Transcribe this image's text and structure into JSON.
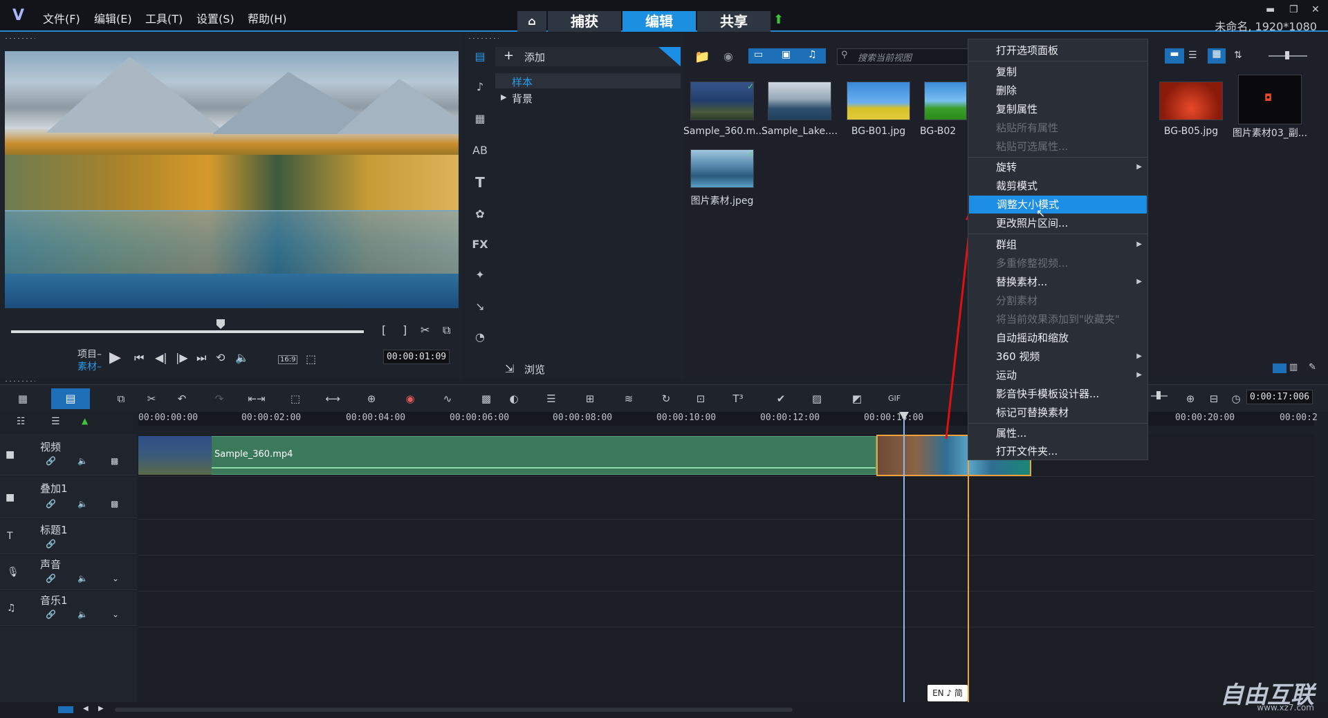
{
  "menubar": {
    "file": "文件(F)",
    "edit": "编辑(E)",
    "tools": "工具(T)",
    "settings": "设置(S)",
    "help": "帮助(H)"
  },
  "nav": {
    "capture": "捕获",
    "edit": "编辑",
    "share": "共享"
  },
  "window": {
    "title": "未命名, 1920*1080"
  },
  "player": {
    "project_label": "项目–",
    "clip_label": "素材–",
    "aspect": "16:9",
    "timecode": "00:00:01:09"
  },
  "library": {
    "add_label": "添加",
    "folders": [
      "样本",
      "背景"
    ],
    "browse_label": "浏览",
    "search_placeholder": "搜索当前视图",
    "thumbnails": [
      "Sample_360.m...",
      "Sample_Lake....",
      "BG-B01.jpg",
      "BG-B02",
      "BG-B05.jpg",
      "图片素材03_副...",
      "图片素材.jpeg"
    ]
  },
  "context_menu": {
    "items": [
      {
        "label": "打开选项面板",
        "disabled": false,
        "submenu": false
      },
      {
        "label": "复制",
        "disabled": false,
        "submenu": false
      },
      {
        "label": "删除",
        "disabled": false,
        "submenu": false
      },
      {
        "label": "复制属性",
        "disabled": false,
        "submenu": false
      },
      {
        "label": "粘贴所有属性",
        "disabled": true,
        "submenu": false
      },
      {
        "label": "粘贴可选属性...",
        "disabled": true,
        "submenu": false
      },
      {
        "label": "旋转",
        "disabled": false,
        "submenu": true
      },
      {
        "label": "裁剪模式",
        "disabled": false,
        "submenu": false
      },
      {
        "label": "调整大小模式",
        "disabled": false,
        "submenu": false,
        "highlighted": true
      },
      {
        "label": "更改照片区间...",
        "disabled": false,
        "submenu": false
      },
      {
        "label": "群组",
        "disabled": false,
        "submenu": true
      },
      {
        "label": "多重修整视频...",
        "disabled": true,
        "submenu": false
      },
      {
        "label": "替换素材...",
        "disabled": false,
        "submenu": true
      },
      {
        "label": "分割素材",
        "disabled": true,
        "submenu": false
      },
      {
        "label": "将当前效果添加到\"收藏夹\"",
        "disabled": true,
        "submenu": false
      },
      {
        "label": "自动摇动和缩放",
        "disabled": false,
        "submenu": false
      },
      {
        "label": "360 视频",
        "disabled": false,
        "submenu": true
      },
      {
        "label": "运动",
        "disabled": false,
        "submenu": true
      },
      {
        "label": "影音快手模板设计器...",
        "disabled": false,
        "submenu": false
      },
      {
        "label": "标记可替换素材",
        "disabled": false,
        "submenu": false
      },
      {
        "label": "属性...",
        "disabled": false,
        "submenu": false
      },
      {
        "label": "打开文件夹...",
        "disabled": false,
        "submenu": false
      }
    ]
  },
  "timeline": {
    "ruler": [
      "00:00:00:00",
      "00:00:02:00",
      "00:00:04:00",
      "00:00:06:00",
      "00:00:08:00",
      "00:00:10:00",
      "00:00:12:00",
      "00:00:14:00",
      "00:00:20:00",
      "00:00:2"
    ],
    "zoom_timecode": "0:00:17:006",
    "tracks": [
      "视频",
      "叠加1",
      "标题1",
      "声音",
      "音乐1"
    ],
    "clip_label": "Sample_360.mp4"
  },
  "ime": "EN ♪ 简",
  "watermark": {
    "text": "自由互联",
    "url": "www.xz7.com"
  },
  "colors": {
    "accent": "#1c8ee6",
    "clip_green": "#3a7a5a",
    "overlay_border": "#f0a33a"
  }
}
